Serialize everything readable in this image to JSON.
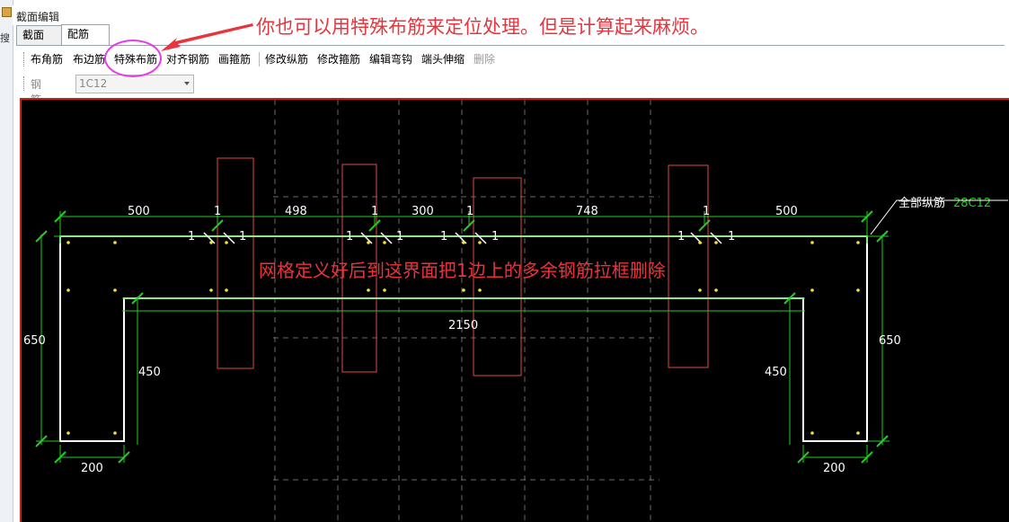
{
  "window": {
    "title": "截面编辑"
  },
  "left_strip": {
    "glyph": "搜"
  },
  "tabs": [
    {
      "label": "截面",
      "active": false
    },
    {
      "label": "配筋",
      "active": true
    }
  ],
  "toolbar": {
    "items": [
      {
        "label": "布角筋",
        "enabled": true
      },
      {
        "label": "布边筋",
        "enabled": true
      },
      {
        "label": "特殊布筋",
        "enabled": true
      },
      {
        "label": "对齐钢筋",
        "enabled": true
      },
      {
        "label": "画箍筋",
        "enabled": true
      },
      {
        "label": "修改纵筋",
        "enabled": true
      },
      {
        "label": "修改箍筋",
        "enabled": true
      },
      {
        "label": "编辑弯钩",
        "enabled": true
      },
      {
        "label": "端头伸缩",
        "enabled": true
      },
      {
        "label": "删除",
        "enabled": false
      }
    ]
  },
  "rebar_info": {
    "label": "钢筋信息",
    "value": "1C12"
  },
  "annotations": {
    "top": "你也可以用特殊布筋来定位处理。但是计算起来麻烦。",
    "canvas": "网格定义好后到这界面把1边上的多余钢筋拉框删除"
  },
  "drawing": {
    "top_dims": [
      "500",
      "498",
      "300",
      "748",
      "500"
    ],
    "grid_marks": [
      "1",
      "1",
      "1",
      "1"
    ],
    "side_marks": [
      "1",
      "1",
      "1",
      "1",
      "1",
      "1",
      "1",
      "1"
    ],
    "total_width": "2150",
    "left_height": "650",
    "right_height": "650",
    "left_inner": "450",
    "right_inner": "450",
    "bottom_left": "200",
    "bottom_right": "200",
    "rebar_label": "全部纵筋",
    "rebar_spec": "28C12",
    "colors": {
      "background": "#000000",
      "outline": "#ffffff",
      "dimension": "#22cc22",
      "grid": "#e04848",
      "rebar": "#f2e23a",
      "annotation": "#e8343c",
      "highlight": "#e43be8"
    }
  }
}
